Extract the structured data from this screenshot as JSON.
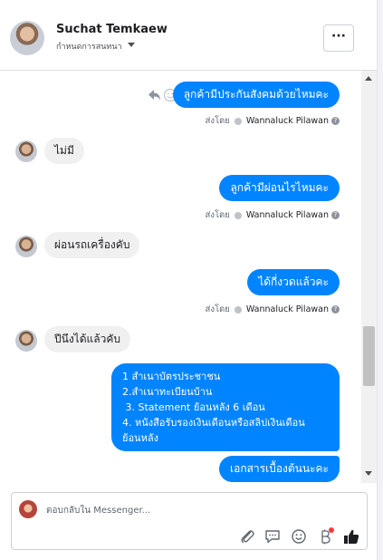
{
  "header": {
    "name": "Suchat Temkaew",
    "subtitle": "กำหนดการสนทนา",
    "more_label": "···"
  },
  "messages": [
    {
      "dir": "out",
      "text": "ลูกค้ามีประกันสังคมด้วยไหมคะ",
      "sent_prefix": "ส่งโดย",
      "sent_by": "Wannaluck Pilawan"
    },
    {
      "dir": "in",
      "text": "ไม่มี"
    },
    {
      "dir": "out",
      "text": "ลูกค้ามีผ่อนไรไหมคะ",
      "sent_prefix": "ส่งโดย",
      "sent_by": "Wannaluck Pilawan"
    },
    {
      "dir": "in",
      "text": "ผ่อนรถเครื่องคับ"
    },
    {
      "dir": "out",
      "text": "ได้กี่งวดแล้วคะ",
      "sent_prefix": "ส่งโดย",
      "sent_by": "Wannaluck Pilawan"
    },
    {
      "dir": "in",
      "text": "ปีนึงได้แล้วคับ"
    },
    {
      "dir": "out_multi",
      "lines": [
        "1 สำเนาบัตรประชาชน",
        "2.สำเนาทะเบียนบ้าน",
        " 3. Statement ย้อนหลัง 6 เดือน",
        "4. หนังสือรับรองเงินเดือนหรือสลิปเงินเดือน",
        "ย้อนหลัง"
      ]
    },
    {
      "dir": "out",
      "text": "เอกสารเบื้องต้นนะคะ"
    }
  ],
  "composer": {
    "placeholder": "ตอบกลับใน Messenger..."
  },
  "colors": {
    "outgoing_bubble": "#0084ff",
    "incoming_bubble": "#f1f0f0",
    "like_icon": "#1c1e21"
  },
  "icons": [
    "reply-icon",
    "emoji-icon",
    "attachment-icon",
    "saved-replies-icon",
    "smiley-icon",
    "bot-icon",
    "like-icon"
  ]
}
